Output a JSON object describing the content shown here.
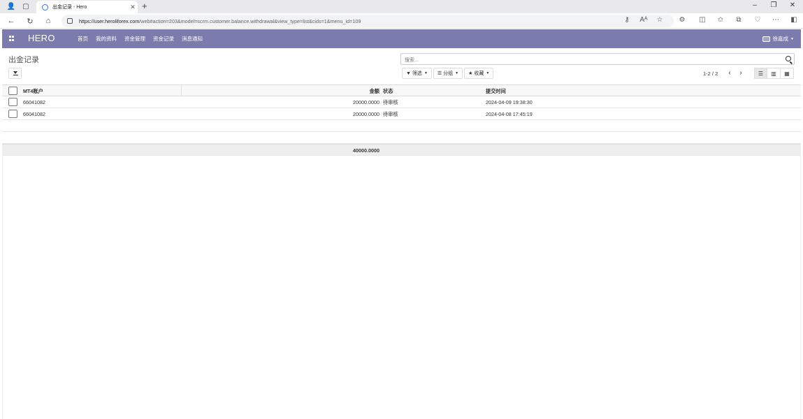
{
  "browser": {
    "tab_title": "出金记录 - Hero",
    "url_domain": "https://user.heroliforex.com",
    "url_path": "/web#action=203&model=scrm.customer.balance.withdrawal&view_type=list&cids=1&menu_id=109"
  },
  "navbar": {
    "brand": "HERO",
    "menu": [
      "首页",
      "我的资料",
      "资金管理",
      "资金记录",
      "消息通知"
    ],
    "user": "徐嘉成"
  },
  "control_panel": {
    "breadcrumb": "出金记录",
    "search_placeholder": "搜索...",
    "filters_label": "筛选",
    "groupby_label": "分组",
    "favorites_label": "收藏",
    "pager": "1-2 / 2"
  },
  "table": {
    "columns": [
      "MT4账户",
      "金额",
      "状态",
      "提交时间"
    ],
    "rows": [
      {
        "account": "66041082",
        "amount": "20000.0000",
        "status": "待审核",
        "time": "2024-04-09 19:38:30"
      },
      {
        "account": "66041082",
        "amount": "20000.0000",
        "status": "待审核",
        "time": "2024-04-08 17:45:19"
      }
    ],
    "total_amount": "40000.0000"
  }
}
